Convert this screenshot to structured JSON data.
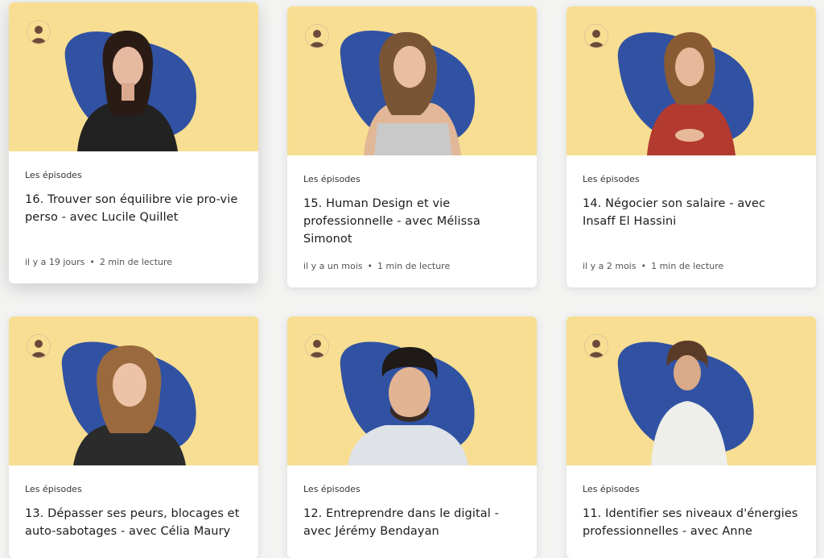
{
  "colors": {
    "cover": "#f7de92",
    "blob": "#3152a3"
  },
  "cards": [
    {
      "category": "Les épisodes",
      "title": "16. Trouver son équilibre vie pro-vie perso - avec Lucile Quillet",
      "age": "il y a 19 jours",
      "read_time": "2 min de lecture"
    },
    {
      "category": "Les épisodes",
      "title": "15. Human Design et vie professionnelle - avec Mélissa Simonot",
      "age": "il y a un mois",
      "read_time": "1 min de lecture"
    },
    {
      "category": "Les épisodes",
      "title": "14. Négocier son salaire - avec Insaff El Hassini",
      "age": "il y a 2 mois",
      "read_time": "1 min de lecture"
    },
    {
      "category": "Les épisodes",
      "title": "13. Dépasser ses peurs, blocages et auto-sabotages - avec Célia Maury",
      "age": "",
      "read_time": ""
    },
    {
      "category": "Les épisodes",
      "title": "12. Entreprendre dans le digital - avec Jérémy Bendayan",
      "age": "",
      "read_time": ""
    },
    {
      "category": "Les épisodes",
      "title": "11. Identifier ses niveaux d'énergies professionnelles - avec Anne",
      "age": "",
      "read_time": ""
    }
  ]
}
